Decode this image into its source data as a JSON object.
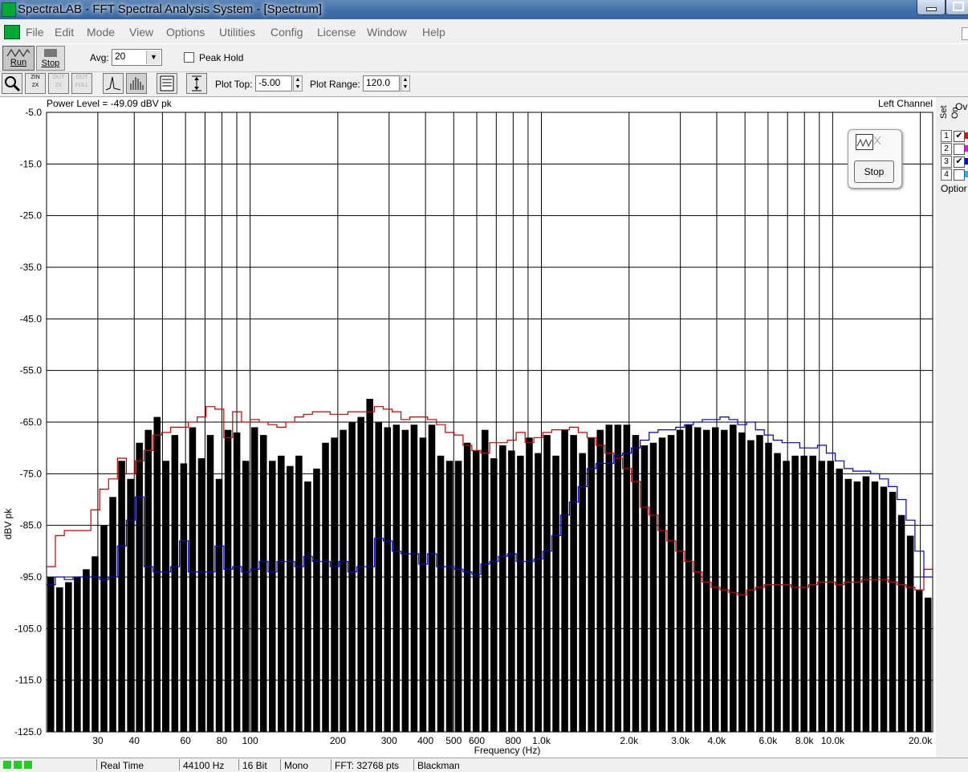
{
  "window": {
    "title": "SpectraLAB - FFT Spectral Analysis System - [Spectrum]"
  },
  "menu": [
    "File",
    "Edit",
    "Mode",
    "View",
    "Options",
    "Utilities",
    "Config",
    "License",
    "Window",
    "Help"
  ],
  "toolbar": {
    "run_label": "Run",
    "stop_label": "Stop",
    "avg_label": "Avg:",
    "avg_value": "20",
    "peak_hold_label": "Peak Hold",
    "plot_top_label": "Plot Top:",
    "plot_top_value": "-5.00",
    "plot_range_label": "Plot Range:",
    "plot_range_value": "120.0"
  },
  "plot": {
    "power_level": "Power Level = -49.09 dBV pk",
    "channel": "Left Channel"
  },
  "side_panel": {
    "header_ov": "Ov",
    "header_set": "Set",
    "header_on": "On",
    "rows": [
      {
        "num": "1",
        "checked": true,
        "color": "#ff0000"
      },
      {
        "num": "2",
        "checked": false,
        "color": "#ff00ff"
      },
      {
        "num": "3",
        "checked": true,
        "color": "#0000ff"
      },
      {
        "num": "4",
        "checked": false,
        "color": "#00c0ff"
      }
    ],
    "options_label": "Optior"
  },
  "mini_dialog": {
    "stop_label": "Stop"
  },
  "statusbar": [
    "Real Time",
    "44100 Hz",
    "16 Bit",
    "Mono",
    "FFT: 32768 pts",
    "Blackman"
  ],
  "chart_data": {
    "type": "bar",
    "xlabel": "Frequency (Hz)",
    "ylabel": "dBV pk",
    "x_scale": "log",
    "xlim": [
      20,
      22050
    ],
    "ylim": [
      -125,
      -5
    ],
    "y_ticks": [
      "-5.0",
      "-15.0",
      "-25.0",
      "-35.0",
      "-45.0",
      "-55.0",
      "-65.0",
      "-75.0",
      "-85.0",
      "-95.0",
      "-105.0",
      "-115.0",
      "-125.0"
    ],
    "x_ticks": [
      {
        "f": 30,
        "label": "30"
      },
      {
        "f": 40,
        "label": "40"
      },
      {
        "f": 60,
        "label": "60"
      },
      {
        "f": 80,
        "label": "80"
      },
      {
        "f": 100,
        "label": "100"
      },
      {
        "f": 200,
        "label": "200"
      },
      {
        "f": 300,
        "label": "300"
      },
      {
        "f": 400,
        "label": "400"
      },
      {
        "f": 500,
        "label": "500"
      },
      {
        "f": 600,
        "label": "600"
      },
      {
        "f": 800,
        "label": "800"
      },
      {
        "f": 1000,
        "label": "1.0k"
      },
      {
        "f": 2000,
        "label": "2.0k"
      },
      {
        "f": 3000,
        "label": "3.0k"
      },
      {
        "f": 4000,
        "label": "4.0k"
      },
      {
        "f": 6000,
        "label": "6.0k"
      },
      {
        "f": 8000,
        "label": "8.0k"
      },
      {
        "f": 10000,
        "label": "10.0k"
      },
      {
        "f": 20000,
        "label": "20.0k"
      }
    ],
    "grid_lines_hz": [
      30,
      40,
      50,
      60,
      70,
      80,
      90,
      100,
      200,
      300,
      400,
      500,
      600,
      700,
      800,
      900,
      1000,
      2000,
      3000,
      4000,
      5000,
      6000,
      7000,
      8000,
      9000,
      10000,
      20000
    ],
    "bars_db": [
      -95,
      -97,
      -96,
      -95,
      -93.5,
      -91,
      -85,
      -79.5,
      -72.5,
      -76,
      -69,
      -66.5,
      -64,
      -72.5,
      -67.5,
      -73,
      -66,
      -72,
      -67.5,
      -76,
      -66.5,
      -67,
      -72.5,
      -66,
      -67.5,
      -72.5,
      -71.5,
      -73.5,
      -71.5,
      -76.5,
      -74,
      -69,
      -68,
      -66.5,
      -65,
      -64,
      -60.5,
      -65,
      -66,
      -65.5,
      -66.5,
      -65.5,
      -68,
      -65.5,
      -71.5,
      -72.5,
      -72.5,
      -69,
      -70.5,
      -66.5,
      -72,
      -69.5,
      -70.5,
      -71.5,
      -68,
      -71,
      -67.5,
      -71.5,
      -66.5,
      -67.5,
      -71,
      -68,
      -66.5,
      -65.5,
      -65.5,
      -65.5,
      -67.5,
      -69.5,
      -69,
      -68,
      -67.5,
      -66.5,
      -65.5,
      -66,
      -66.5,
      -66,
      -66.5,
      -65.5,
      -67,
      -68.5,
      -67.5,
      -69,
      -71,
      -72.5,
      -71.5,
      -71.5,
      -71.5,
      -72.5,
      -72.5,
      -74,
      -76,
      -76.5,
      -75.5,
      -76.5,
      -77.5,
      -78.5,
      -83,
      -87,
      -97.5,
      -99
    ],
    "series": [
      {
        "color": "#cc0000",
        "values": [
          -93,
          -87,
          -86,
          -86,
          -86,
          -82,
          -78,
          -76,
          -72,
          -75,
          -72.5,
          -70.5,
          -67.5,
          -67,
          -66,
          -66,
          -65,
          -64,
          -62,
          -62.5,
          -68,
          -63,
          -65,
          -64.5,
          -65,
          -65.5,
          -66,
          -65,
          -64,
          -63.5,
          -63,
          -63,
          -63.5,
          -63.5,
          -63,
          -63,
          -63,
          -62,
          -62.5,
          -63,
          -64.5,
          -64,
          -64,
          -64.5,
          -65.5,
          -67,
          -67.5,
          -69.5,
          -70.5,
          -71,
          -69,
          -69,
          -68.5,
          -67,
          -69,
          -68,
          -67,
          -66.5,
          -66.5,
          -66,
          -67,
          -68,
          -69.5,
          -71,
          -72,
          -74,
          -76.5,
          -81.5,
          -83,
          -86,
          -88,
          -90,
          -92,
          -94,
          -96,
          -97,
          -97.5,
          -98,
          -98.5,
          -97.5,
          -97,
          -96.5,
          -96.5,
          -96.5,
          -97,
          -97,
          -96.5,
          -96,
          -96,
          -96.5,
          -96,
          -96,
          -95.5,
          -95.5,
          -95.5,
          -96,
          -96.5,
          -97,
          -97.5,
          -93.5
        ]
      },
      {
        "color": "#0000cc",
        "values": [
          -96.5,
          -95,
          -95.5,
          -95,
          -95,
          -95,
          -95.5,
          -95,
          -89,
          -84,
          -79.5,
          -93,
          -94,
          -94,
          -93,
          -88,
          -94,
          -94,
          -94,
          -89,
          -93.5,
          -93,
          -94,
          -93.5,
          -92,
          -94,
          -92,
          -92,
          -93,
          -91,
          -92,
          -92,
          -93,
          -92,
          -94,
          -93,
          -93,
          -87.5,
          -88,
          -90,
          -90.5,
          -90.5,
          -92.5,
          -90.5,
          -93,
          -93,
          -93.5,
          -94,
          -94.5,
          -92.5,
          -92,
          -91,
          -90.5,
          -92,
          -92,
          -91.5,
          -90,
          -87,
          -83,
          -80.5,
          -77.5,
          -74,
          -73,
          -73,
          -71.5,
          -71,
          -70,
          -68.5,
          -67,
          -66.5,
          -66.5,
          -66,
          -65.5,
          -65,
          -64.5,
          -64.5,
          -64,
          -64.5,
          -65.5,
          -65,
          -66.5,
          -67.5,
          -68.5,
          -69,
          -69,
          -70,
          -70,
          -69.5,
          -71,
          -72.5,
          -74,
          -74.5,
          -74.5,
          -75,
          -76,
          -77.5,
          -80,
          -84,
          -90,
          -95
        ]
      }
    ]
  }
}
